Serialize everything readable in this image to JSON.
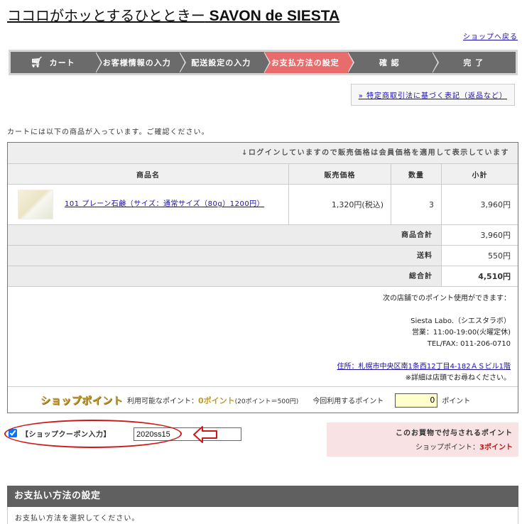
{
  "header": {
    "title_prefix": "ココロがホッとするひとときー",
    "title_brand": " SAVON de SIESTA",
    "back_link": "ショップへ戻る"
  },
  "steps": [
    {
      "label": "カート",
      "icon": "cart-icon",
      "active": false
    },
    {
      "label": "お客様情報の入力",
      "active": false
    },
    {
      "label": "配送設定の入力",
      "active": false
    },
    {
      "label": "お支払方法の設定",
      "active": true
    },
    {
      "label": "確 認",
      "active": false
    },
    {
      "label": "完 了",
      "active": false
    }
  ],
  "law_link": "» 特定商取引法に基づく表記（返品など）",
  "cart": {
    "intro": "カートには以下の商品が入っています。ご確認ください。",
    "login_note": "↓ログインしていますので販売価格は会員価格を適用して表示しています",
    "columns": [
      "商品名",
      "販売価格",
      "数量",
      "小計"
    ],
    "items": [
      {
        "name": "101 プレーン石鹸（サイズ：通常サイズ（80g）1200円）",
        "price": "1,320円(税込)",
        "qty": "3",
        "subtotal": "3,960円"
      }
    ],
    "summary": [
      {
        "label": "商品合計",
        "value": "3,960円"
      },
      {
        "label": "送料",
        "value": "550円"
      },
      {
        "label": "総合計",
        "value": "4,510円"
      }
    ]
  },
  "shop_info": {
    "intro": "次の店舗でのポイント使用ができます：",
    "name": "Siesta Labo.（シエスタラボ）",
    "hours": "営業：11:00-19:00(火曜定休)",
    "tel": "TEL/FAX: 011-206-0710",
    "address": "住所：札幌市中央区南1条西12丁目4-182ＡＳビル1階",
    "note": "※詳細は店頭でお尋ねください。"
  },
  "points": {
    "logo": "ショップポイント",
    "available_label": "利用可能なポイント：",
    "available_value": "0ポイント",
    "rate": "(20ポイント＝500円)",
    "use_label": "今回利用するポイント",
    "use_value": "0",
    "unit": "ポイント"
  },
  "coupon": {
    "checked": true,
    "label": "【ショップクーポン入力】",
    "value": "2020ss15"
  },
  "earn": {
    "title": "このお買物で付与されるポイント",
    "label": "ショップポイント：",
    "value": "3ポイント"
  },
  "payment": {
    "heading": "お支払い方法の設定",
    "instruction": "お支払い方法を選択してください。"
  },
  "colors": {
    "active_step": "#e86c6c",
    "step": "#6b6b6b",
    "annotation": "#d01818",
    "points_gold": "#c49a2e"
  }
}
